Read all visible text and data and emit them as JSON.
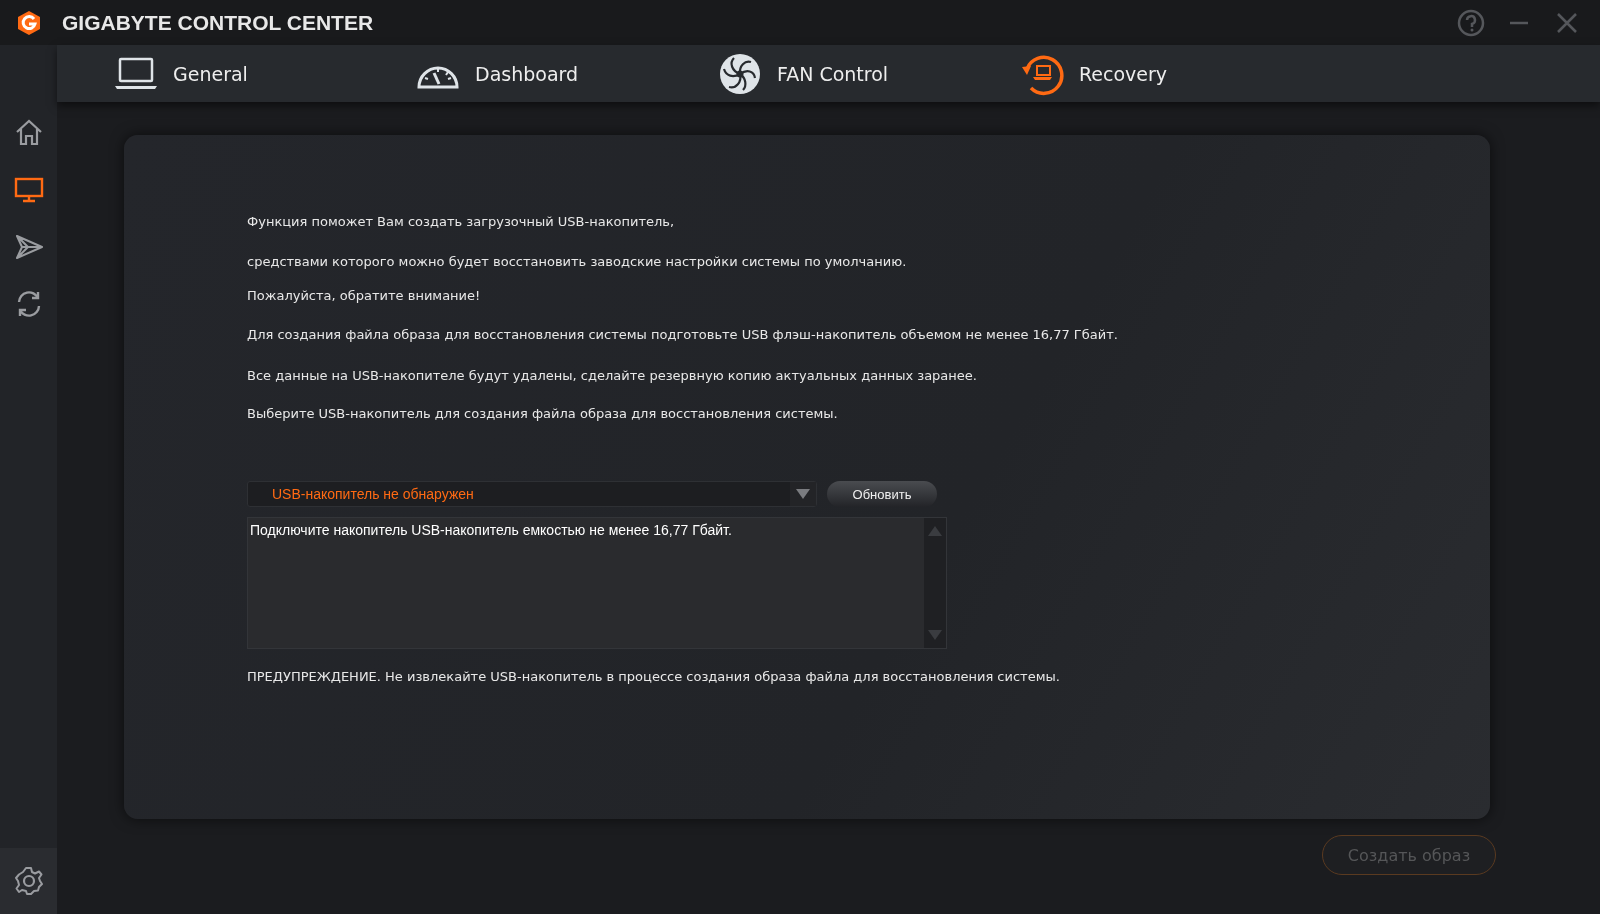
{
  "window": {
    "title": "GIGABYTE CONTROL CENTER"
  },
  "tabs": [
    {
      "label": "General",
      "kind": "laptop",
      "selected": false
    },
    {
      "label": "Dashboard",
      "kind": "gauge",
      "selected": false
    },
    {
      "label": "FAN Control",
      "kind": "fan",
      "selected": false
    },
    {
      "label": "Recovery",
      "kind": "recovery",
      "selected": true
    }
  ],
  "sidebar": {
    "items": [
      {
        "kind": "home",
        "selected": false
      },
      {
        "kind": "monitor",
        "selected": true
      },
      {
        "kind": "plane",
        "selected": false
      },
      {
        "kind": "sync",
        "selected": false
      }
    ]
  },
  "content": {
    "paragraphs": [
      "Функция поможет Вам создать загрузочный USB-накопитель,",
      "средствами которого можно будет восстановить заводские настройки системы по умолчанию.",
      "Пожалуйста, обратите внимание!",
      "Для создания файла образа для восстановления системы подготовьте USB флэш-накопитель объемом не менее 16,77 Гбайт.",
      "Все данные на USB-накопителе будут удалены, сделайте резервную копию актуальных данных заранее.",
      "Выберите USB-накопитель для создания файла образа для восстановления системы."
    ],
    "drive_select": {
      "value": "USB-накопитель не обнаружен"
    },
    "refresh_button": "Обновить",
    "log": "Подключите накопитель USB-накопитель емкостью не менее 16,77 Гбайт.",
    "warning": "ПРЕДУПРЕЖДЕНИЕ. Не извлекайте USB-накопитель в процессе создания образа файла для восстановления системы.",
    "create_button": {
      "label": "Создать образ",
      "disabled": true
    }
  }
}
